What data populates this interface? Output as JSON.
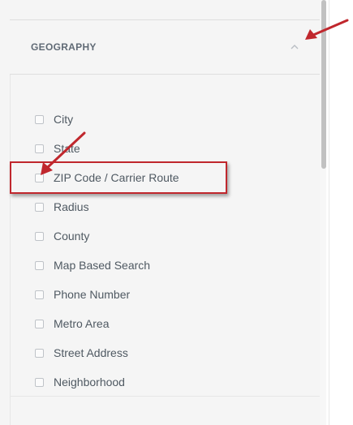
{
  "section": {
    "title": "GEOGRAPHY",
    "collapse_icon": "chevron-up-icon"
  },
  "options": [
    {
      "label": "City",
      "checked": false
    },
    {
      "label": "State",
      "checked": false
    },
    {
      "label": "ZIP Code / Carrier Route",
      "checked": false
    },
    {
      "label": "Radius",
      "checked": false
    },
    {
      "label": "County",
      "checked": false
    },
    {
      "label": "Map Based Search",
      "checked": false
    },
    {
      "label": "Phone Number",
      "checked": false
    },
    {
      "label": "Metro Area",
      "checked": false
    },
    {
      "label": "Street Address",
      "checked": false
    },
    {
      "label": "Neighborhood",
      "checked": false
    }
  ],
  "annotations": {
    "highlight_color": "#c0272d",
    "arrow_color": "#c0272d"
  }
}
